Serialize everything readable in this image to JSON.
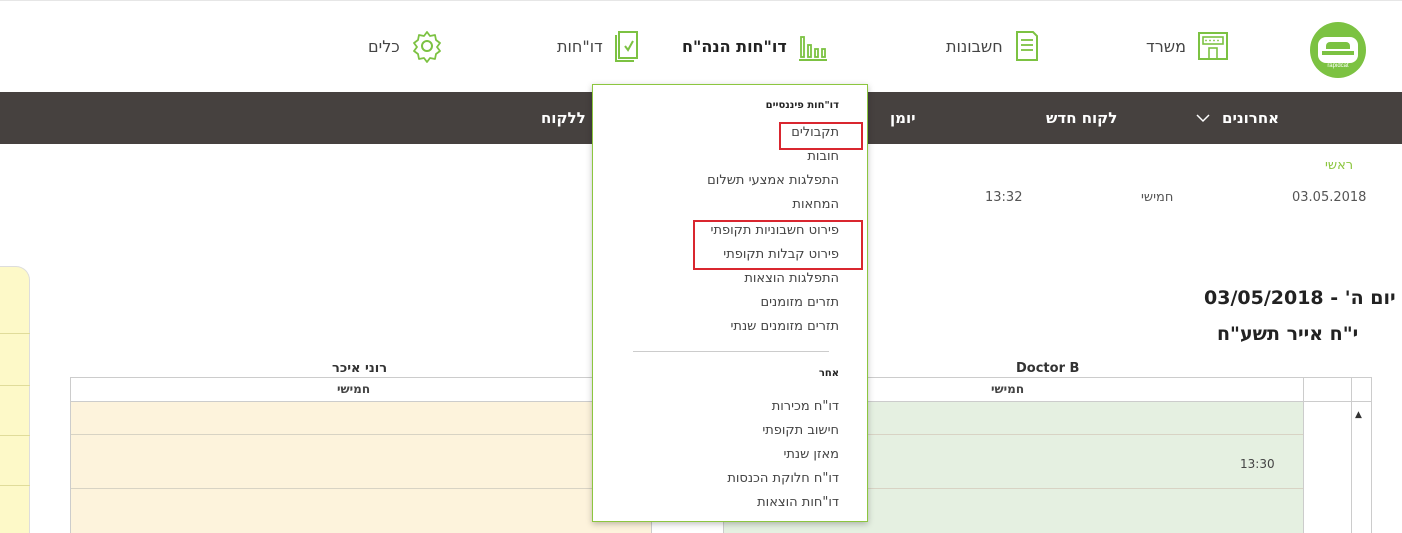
{
  "brand": {
    "logo_text": "rapidcat"
  },
  "nav": {
    "office": "משרד",
    "accounts": "חשבונות",
    "accounting_reports": "דו\"חות הנה\"ח",
    "reports": "דו\"חות",
    "tools": "כלים"
  },
  "toolbar": {
    "recent": "אחרונים",
    "new_client": "לקוח חדש",
    "diary": "יומן",
    "to_client": "ללקוח"
  },
  "breadcrumb": "ראשי",
  "date_row": {
    "date": "03.05.2018",
    "day": "חמישי",
    "time": "13:32"
  },
  "day_title": "יום ה' - 03/05/2018",
  "hebrew_date": "י\"ח אייר תשע\"ח",
  "calendar": {
    "columns": [
      {
        "name": "רוני איכר",
        "day": "חמישי"
      },
      {
        "name": "Doctor B",
        "day": "חמישי"
      }
    ],
    "time_slot": "13:30"
  },
  "dropdown": {
    "financial_header": "דו\"חות פיננסיים",
    "financial_items": [
      "תקבולים",
      "חובות",
      "התפלגות אמצעי תשלום",
      "המחאות",
      "פירוט חשבוניות תקופתי",
      "פירוט קבלות תקופתי",
      "התפלגות הוצאות",
      "תזרים מזומנים",
      "תזרים מזומנים שנתי"
    ],
    "other_header": "אחר",
    "other_items": [
      "דו\"ח מכירות",
      "חישוב תקופתי",
      "מאזן שנתי",
      "דו\"ח חלוקת הכנסות",
      "דו\"חות הוצאות"
    ]
  },
  "colors": {
    "accent_green": "#8cc63f",
    "dark_bar": "#46413f",
    "highlight_red": "#d9262f"
  }
}
